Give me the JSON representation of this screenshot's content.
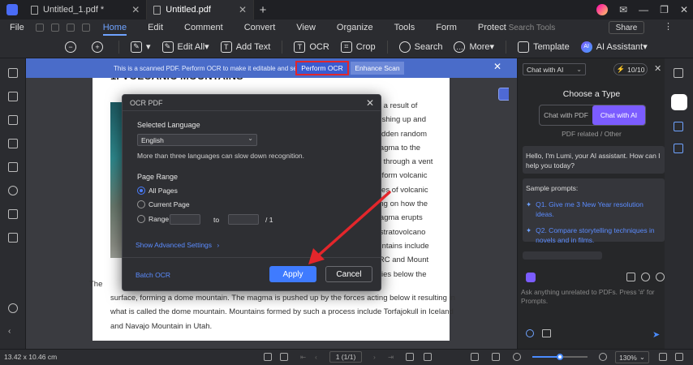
{
  "tabs": [
    {
      "label": "Untitled_1.pdf *"
    },
    {
      "label": "Untitled.pdf"
    }
  ],
  "menubar": {
    "file": "File",
    "items": [
      "Home",
      "Edit",
      "Comment",
      "Convert",
      "View",
      "Organize",
      "Tools",
      "Form",
      "Protect"
    ],
    "active": "Home",
    "search_placeholder": "Search Tools",
    "share": "Share"
  },
  "toolbar": {
    "edit_all": "Edit All",
    "add_text": "Add Text",
    "ocr": "OCR",
    "crop": "Crop",
    "search": "Search",
    "more": "More",
    "template": "Template",
    "ai_assistant": "AI Assistant"
  },
  "banner": {
    "message": "This is a scanned PDF. Perform OCR to make it editable and searchable.",
    "perform_ocr": "Perform OCR",
    "enhance_scan": "Enhance Scan"
  },
  "document": {
    "title": "1. VOLCANIC MOUNTAINS",
    "right_lines": [
      "as a result of",
      "pushing up and",
      "sudden random",
      "magma to the",
      "elf through a vent",
      "to form volcanic",
      "ypes of volcanic",
      "ding on how the",
      "magma erupts",
      "a stratovolcano",
      "ountains include",
      "DRC and Mount"
    ],
    "bottom_lines": [
      "The",
      "surface, forming a dome mountain. The magma is pushed up by the forces acting below it resulting in",
      "what is called the dome mountain. Mountains formed by such a process include Torfajokull in Iceland",
      "and Navajo Mountain in Utah."
    ],
    "bottom_right": "difies below the"
  },
  "ocr_dialog": {
    "title": "OCR PDF",
    "selected_language_label": "Selected Language",
    "language": "English",
    "language_hint": "More than three languages can slow down recognition.",
    "page_range_label": "Page Range",
    "options": [
      "All Pages",
      "Current Page",
      "Range"
    ],
    "selected_option": "All Pages",
    "range_to": "to",
    "range_total": "/ 1",
    "advanced": "Show Advanced Settings",
    "batch": "Batch OCR",
    "apply": "Apply",
    "cancel": "Cancel"
  },
  "ai_panel": {
    "mode": "Chat with AI",
    "credits": "10/10",
    "choose_type": "Choose a Type",
    "type_pdf": "Chat with PDF",
    "type_ai": "Chat with AI",
    "subtitle": "PDF related / Other",
    "greeting": "Hello, I'm Lumi, your AI assistant. How can I help you today?",
    "sample_prompts_label": "Sample prompts:",
    "prompts": [
      "Q1. Give me 3 New Year resolution ideas.",
      "Q2. Compare storytelling techniques in novels and in films."
    ],
    "input_placeholder": "Ask anything unrelated to PDFs. Press '#' for Prompts."
  },
  "status": {
    "dimensions": "13.42 x 10.46 cm",
    "page": "1 (1/1)",
    "zoom": "130%",
    "zoom_level": 0.5
  },
  "colors": {
    "accent": "#3f7bff",
    "ai_purple": "#7b5cff",
    "highlight_red": "#e3262b"
  }
}
